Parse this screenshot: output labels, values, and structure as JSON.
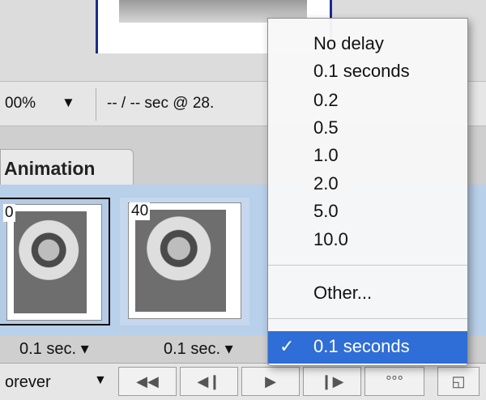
{
  "status_bar": {
    "zoom_value": "00%",
    "dropdown_arrow": "▼",
    "timing_text": "-- / -- sec @ 28."
  },
  "panel": {
    "tab_label": "Animation",
    "frames": [
      {
        "number": "0",
        "delay": "0.1 sec."
      },
      {
        "number": "40",
        "delay": "0.1 sec."
      }
    ],
    "dropdown_caret": "▾"
  },
  "controls": {
    "loop_label": "orever",
    "loop_arrow": "▼",
    "first_frame_glyph": "◀◀",
    "prev_frame_glyph": "◀❙",
    "play_glyph": "▶",
    "next_frame_glyph": "❙▶",
    "tween_glyph": "°°°",
    "new_frame_glyph": "◱"
  },
  "delay_menu": {
    "items": [
      "No delay",
      "0.1 seconds",
      "0.2",
      "0.5",
      "1.0",
      "2.0",
      "5.0",
      "10.0"
    ],
    "other_label": "Other...",
    "selected_label": "0.1 seconds",
    "check_glyph": "✓"
  },
  "colors": {
    "accent": "#2f6ed6",
    "frame_panel": "#b8d0ea",
    "doc_border": "#1b2a8c"
  }
}
